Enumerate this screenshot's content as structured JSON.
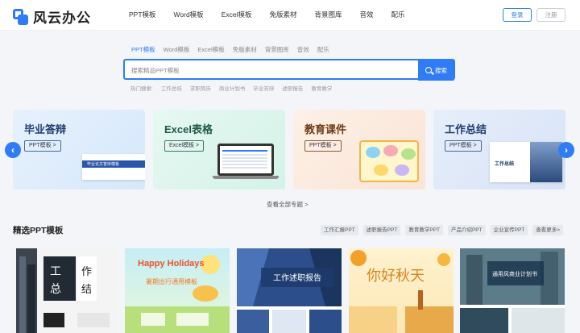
{
  "header": {
    "logo_text": "风云办公",
    "nav": [
      "PPT模板",
      "Word模板",
      "Excel模板",
      "免版素材",
      "背景图库",
      "音效",
      "配乐"
    ],
    "login": "登录",
    "register": "注册"
  },
  "search": {
    "tabs": [
      "PPT模板",
      "Word模板",
      "Excel模板",
      "免版素材",
      "背景图库",
      "音效",
      "配乐"
    ],
    "active_tab": 0,
    "placeholder": "搜索精品PPT模板",
    "button": "搜索",
    "hot_label": "热门搜索:",
    "hot_items": [
      "工作总结",
      "求职简历",
      "商业计划书",
      "毕业答辩",
      "述职报告",
      "教育教学"
    ]
  },
  "banner": {
    "cards": [
      {
        "title": "毕业答辩",
        "tag": "PPT模板 >",
        "thumb_text": "毕业论文答辩模板"
      },
      {
        "title": "Excel表格",
        "tag": "Excel模板 >",
        "thumb_text": ""
      },
      {
        "title": "教育课件",
        "tag": "PPT模板 >",
        "thumb_text": ""
      },
      {
        "title": "工作总结",
        "tag": "PPT模板 >",
        "thumb_text": "工作总结"
      }
    ],
    "prev": "‹",
    "next": "›",
    "view_all": "查看全部专题 >"
  },
  "section": {
    "title": "精选PPT模板",
    "filters": [
      "工作汇报PPT",
      "述职报告PPT",
      "教育教学PPT",
      "产品介绍PPT",
      "企业宣传PPT",
      "查看更多>"
    ],
    "thumbs": [
      {
        "label_a": "工",
        "label_b": "总",
        "label_c": "作",
        "label_d": "结"
      },
      {
        "label_a": "Happy Holidays",
        "label_b": "暑期出行通用模板"
      },
      {
        "label_a": "工作述职报告"
      },
      {
        "label_a": "你好秋天"
      },
      {
        "label_a": "通用风商业计划书"
      }
    ]
  },
  "colors": {
    "accent": "#2f7cf6",
    "page_bg": "#f3f5f9"
  }
}
